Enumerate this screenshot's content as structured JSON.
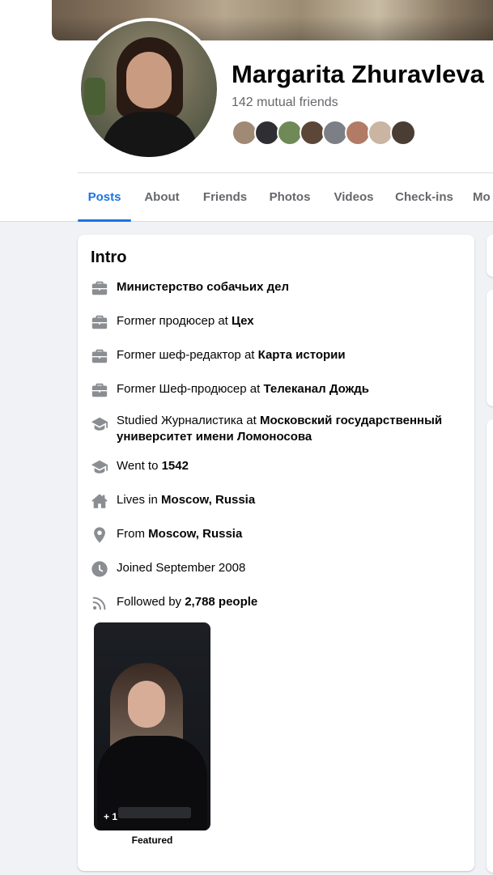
{
  "profile": {
    "name": "Margarita Zhuravleva",
    "mutual_friends": "142 mutual friends"
  },
  "mutual_friend_avatars": [
    {
      "name": "friend-avatar",
      "color": "#a08a76"
    },
    {
      "name": "friend-avatar",
      "color": "#2f2f33"
    },
    {
      "name": "friend-avatar",
      "color": "#6f8a56"
    },
    {
      "name": "friend-avatar",
      "color": "#5b4638"
    },
    {
      "name": "friend-avatar",
      "color": "#7d7f86"
    },
    {
      "name": "friend-avatar",
      "color": "#b27b66"
    },
    {
      "name": "friend-avatar",
      "color": "#c9b5a2"
    },
    {
      "name": "friend-avatar",
      "color": "#4a3d33"
    }
  ],
  "tabs": [
    {
      "label": "Posts",
      "active": true
    },
    {
      "label": "About",
      "active": false
    },
    {
      "label": "Friends",
      "active": false
    },
    {
      "label": "Photos",
      "active": false
    },
    {
      "label": "Videos",
      "active": false
    },
    {
      "label": "Check-ins",
      "active": false
    },
    {
      "label": "Mo",
      "active": false
    }
  ],
  "intro": {
    "title": "Intro",
    "items": [
      {
        "icon": "briefcase-icon",
        "prefix": "",
        "bold": "Министерство собачьих дел"
      },
      {
        "icon": "briefcase-icon",
        "prefix": "Former продюсер at ",
        "bold": "Цех"
      },
      {
        "icon": "briefcase-icon",
        "prefix": "Former шеф-редактор at ",
        "bold": "Карта истории"
      },
      {
        "icon": "briefcase-icon",
        "prefix": "Former Шеф-продюсер at ",
        "bold": "Телеканал Дождь"
      },
      {
        "icon": "graduation-cap-icon",
        "prefix": "Studied Журналистика at ",
        "bold": "Московский государственный университет имени Ломоносова"
      },
      {
        "icon": "graduation-cap-icon",
        "prefix": "Went to ",
        "bold": "1542"
      },
      {
        "icon": "home-icon",
        "prefix": "Lives in ",
        "bold": "Moscow, Russia"
      },
      {
        "icon": "location-pin-icon",
        "prefix": "From ",
        "bold": "Moscow, Russia"
      },
      {
        "icon": "clock-icon",
        "prefix": "Joined September 2008",
        "bold": ""
      },
      {
        "icon": "rss-followers-icon",
        "prefix": "Followed by ",
        "bold": "2,788 people"
      }
    ],
    "featured_count": "+ 1",
    "featured_label": "Featured"
  },
  "colors": {
    "accent": "#1b74e4",
    "secondary_text": "#65676b",
    "icon": "#8a8d91"
  }
}
